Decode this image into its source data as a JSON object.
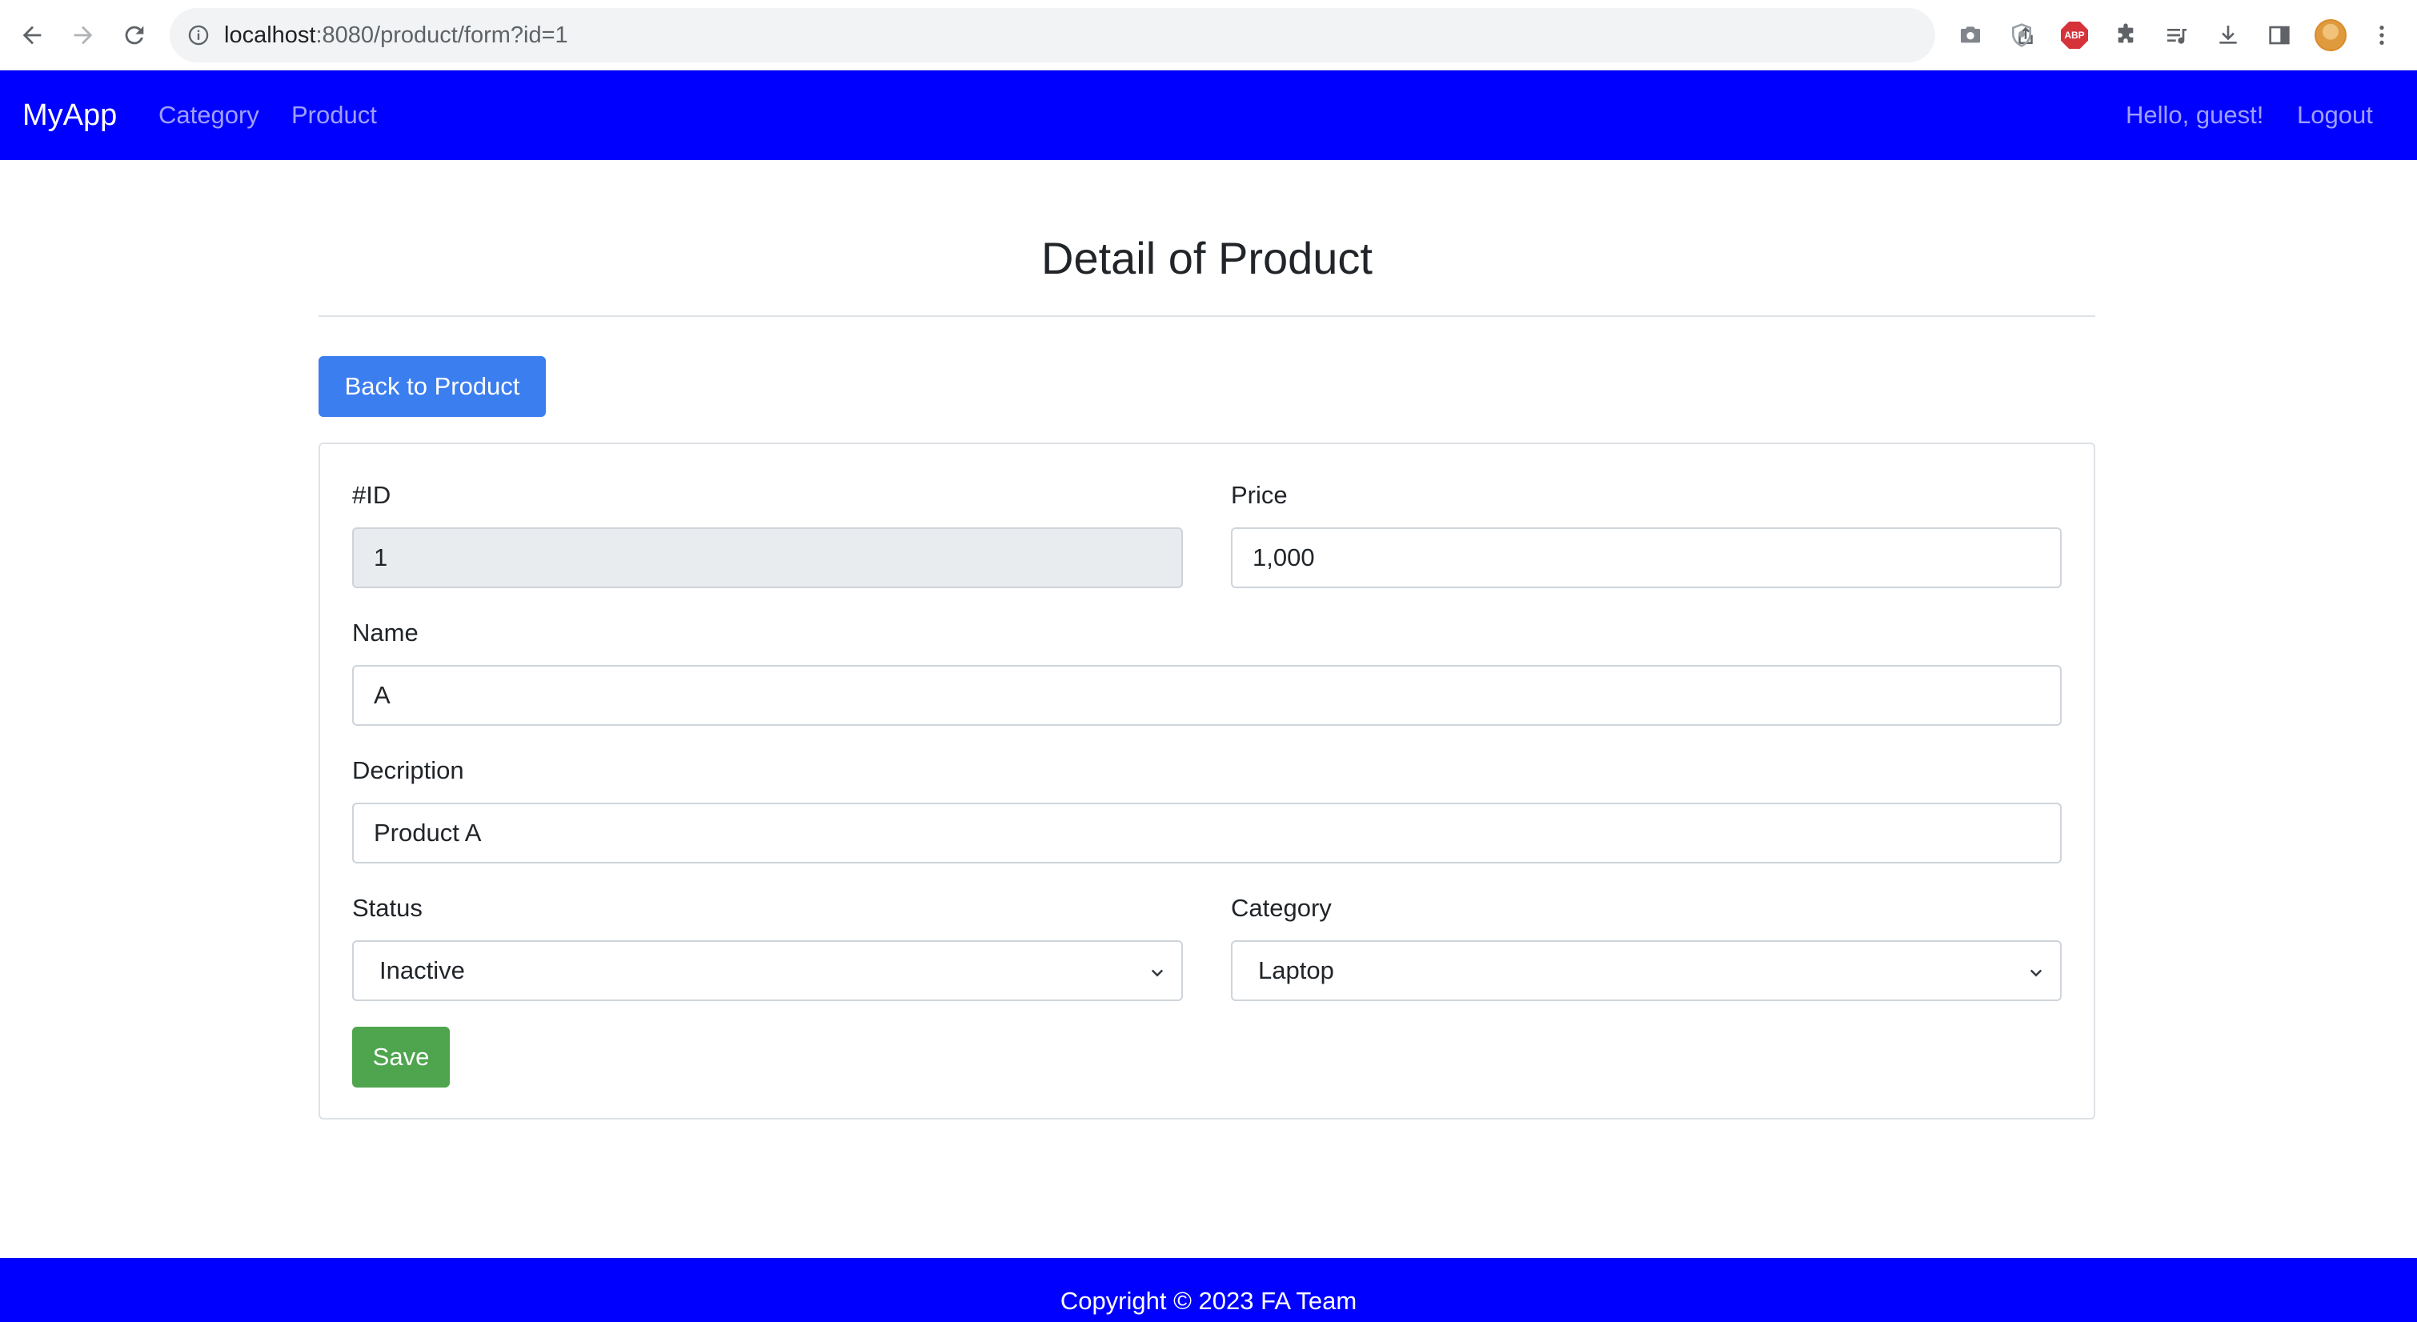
{
  "browser": {
    "url_host": "localhost",
    "url_rest": ":8080/product/form?id=1",
    "abp_label": "ABP"
  },
  "navbar": {
    "brand": "MyApp",
    "links": [
      {
        "label": "Category"
      },
      {
        "label": "Product"
      }
    ],
    "greeting": "Hello, guest!",
    "logout_label": "Logout",
    "color": "#0000ff"
  },
  "page": {
    "title": "Detail of Product",
    "back_button_label": "Back to Product"
  },
  "form": {
    "id": {
      "label": "#ID",
      "value": "1"
    },
    "price": {
      "label": "Price",
      "value": "1,000"
    },
    "name": {
      "label": "Name",
      "value": "A"
    },
    "description": {
      "label": "Decription",
      "value": "Product A"
    },
    "status": {
      "label": "Status",
      "value": "Inactive"
    },
    "category": {
      "label": "Category",
      "value": "Laptop"
    },
    "save_label": "Save"
  },
  "footer": {
    "text": "Copyright © 2023 FA Team"
  },
  "colors": {
    "primary_button": "#3b7ef0",
    "success_button": "#4ea54e"
  }
}
